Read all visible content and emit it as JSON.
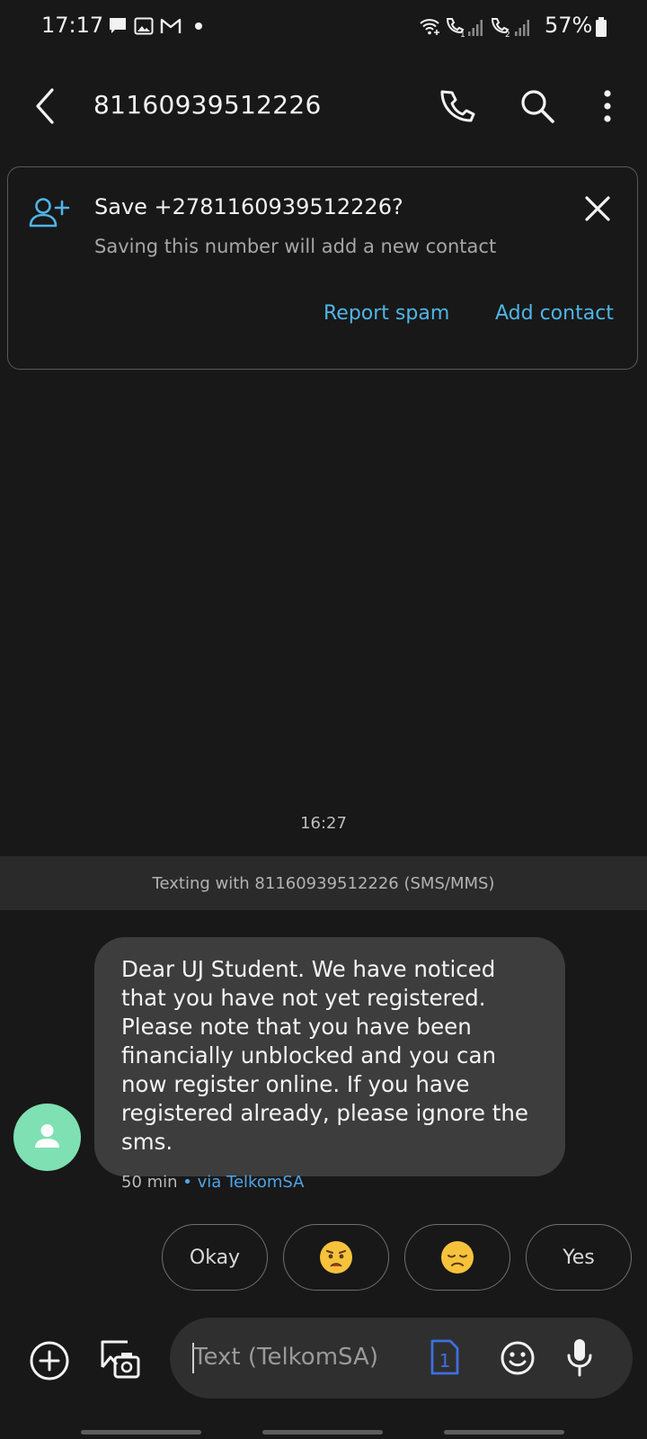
{
  "status_bar": {
    "time": "17:17",
    "battery": "57%",
    "notification_icons": [
      "message-icon",
      "image-icon",
      "gmail-icon",
      "dot-icon"
    ],
    "system_icons": [
      "wifi-calling-icon",
      "volte-sim1-icon",
      "signal-sim1-icon",
      "volte-sim2-icon",
      "signal-sim2-icon",
      "battery-icon"
    ]
  },
  "header": {
    "title": "81160939512226"
  },
  "save_card": {
    "title": "Save +2781160939512226?",
    "subtitle": "Saving this number will add a new contact",
    "report_spam": "Report spam",
    "add_contact": "Add contact"
  },
  "conversation": {
    "timestamp": "16:27",
    "texting_banner": "Texting with 81160939512226 (SMS/MMS)",
    "message": {
      "text": "Dear UJ Student. We have noticed\nthat you have not yet registered.\nPlease note that you have been\nfinancially unblocked and you can\nnow register online. If you have\nregistered already, please ignore the\nsms.",
      "time_ago": "50 min",
      "carrier": " • via TelkomSA"
    }
  },
  "quick_replies": {
    "okay": "Okay",
    "worried": "😟",
    "sad": "😞",
    "yes": "Yes"
  },
  "composer": {
    "placeholder": "Text (TelkomSA)",
    "sim_number": "1"
  },
  "colors": {
    "background": "#181818",
    "accent": "#4fb5e6",
    "bubble": "#3d3d3d",
    "avatar": "#7ee0b3",
    "sim_blue": "#3f6fe0"
  }
}
